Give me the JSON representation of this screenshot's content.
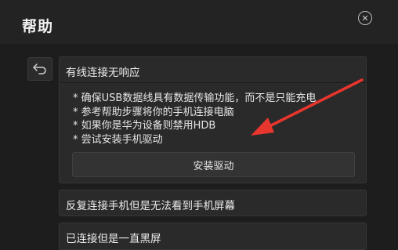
{
  "dialog": {
    "title": "帮助",
    "close_icon": "close-icon"
  },
  "back_icon": "back-arrow-icon",
  "panels": [
    {
      "title": "有线连接无响应",
      "tips": [
        "* 确保USB数据线具有数据传输功能，而不是只能充电",
        "* 参考帮助步骤将你的手机连接电脑",
        "* 如果你是华为设备则禁用HDB",
        "* 尝试安装手机驱动"
      ],
      "button_label": "安装驱动"
    },
    {
      "title": "反复连接手机但是无法看到手机屏幕"
    },
    {
      "title": "已连接但是一直黑屏"
    }
  ],
  "annotation_color": "#e8352e"
}
